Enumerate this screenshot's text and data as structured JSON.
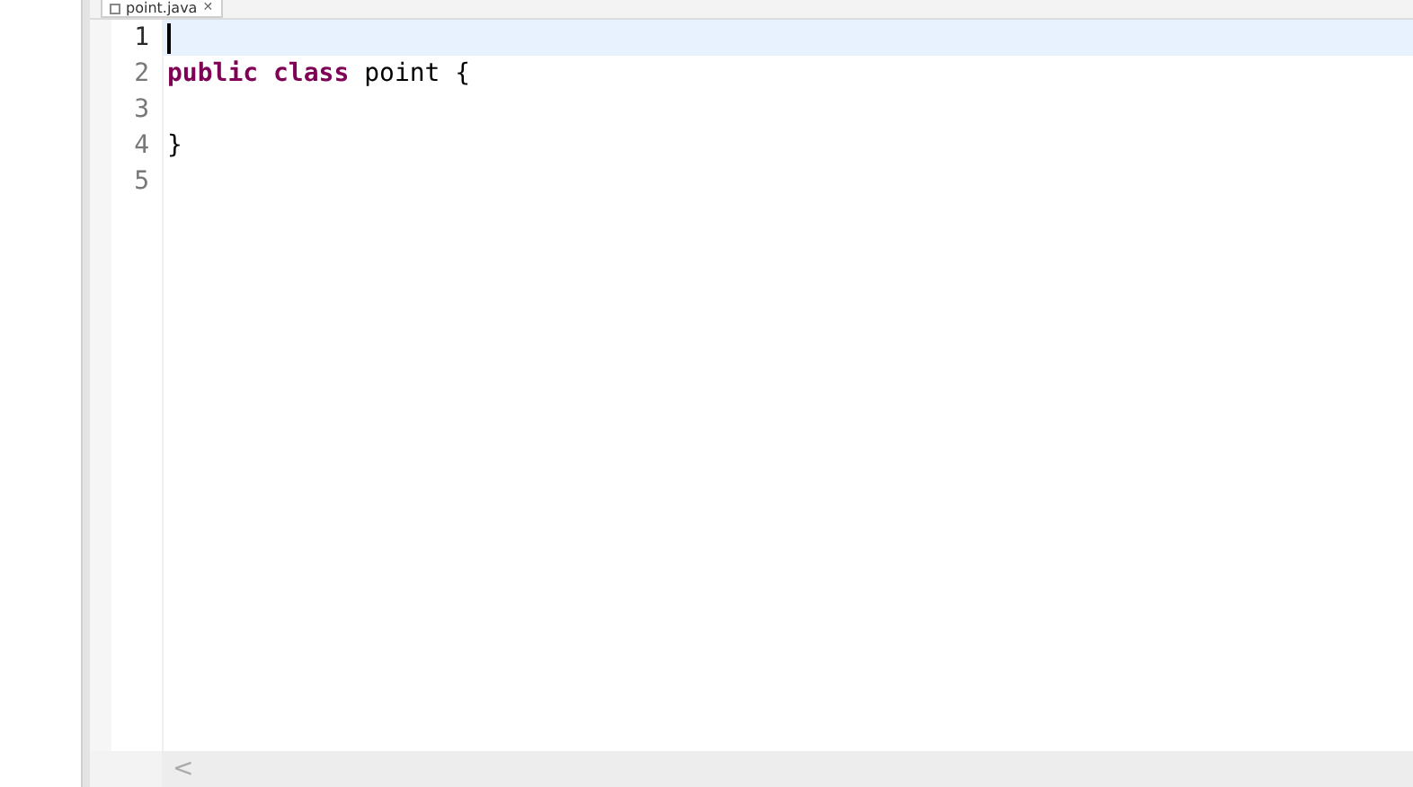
{
  "tab": {
    "label": "point.java",
    "close": "✕"
  },
  "lines": [
    {
      "number": "1",
      "current": true
    },
    {
      "number": "2",
      "current": false,
      "tokens": [
        {
          "kind": "keyword",
          "text": "public"
        },
        {
          "kind": "keyword",
          "text": " class"
        },
        {
          "kind": "plain",
          "text": " point {"
        }
      ]
    },
    {
      "number": "3",
      "current": false
    },
    {
      "number": "4",
      "current": false,
      "tokens": [
        {
          "kind": "plain",
          "text": "}"
        }
      ]
    },
    {
      "number": "5",
      "current": false
    }
  ],
  "scrollbar": {
    "left_arrow": "<"
  }
}
